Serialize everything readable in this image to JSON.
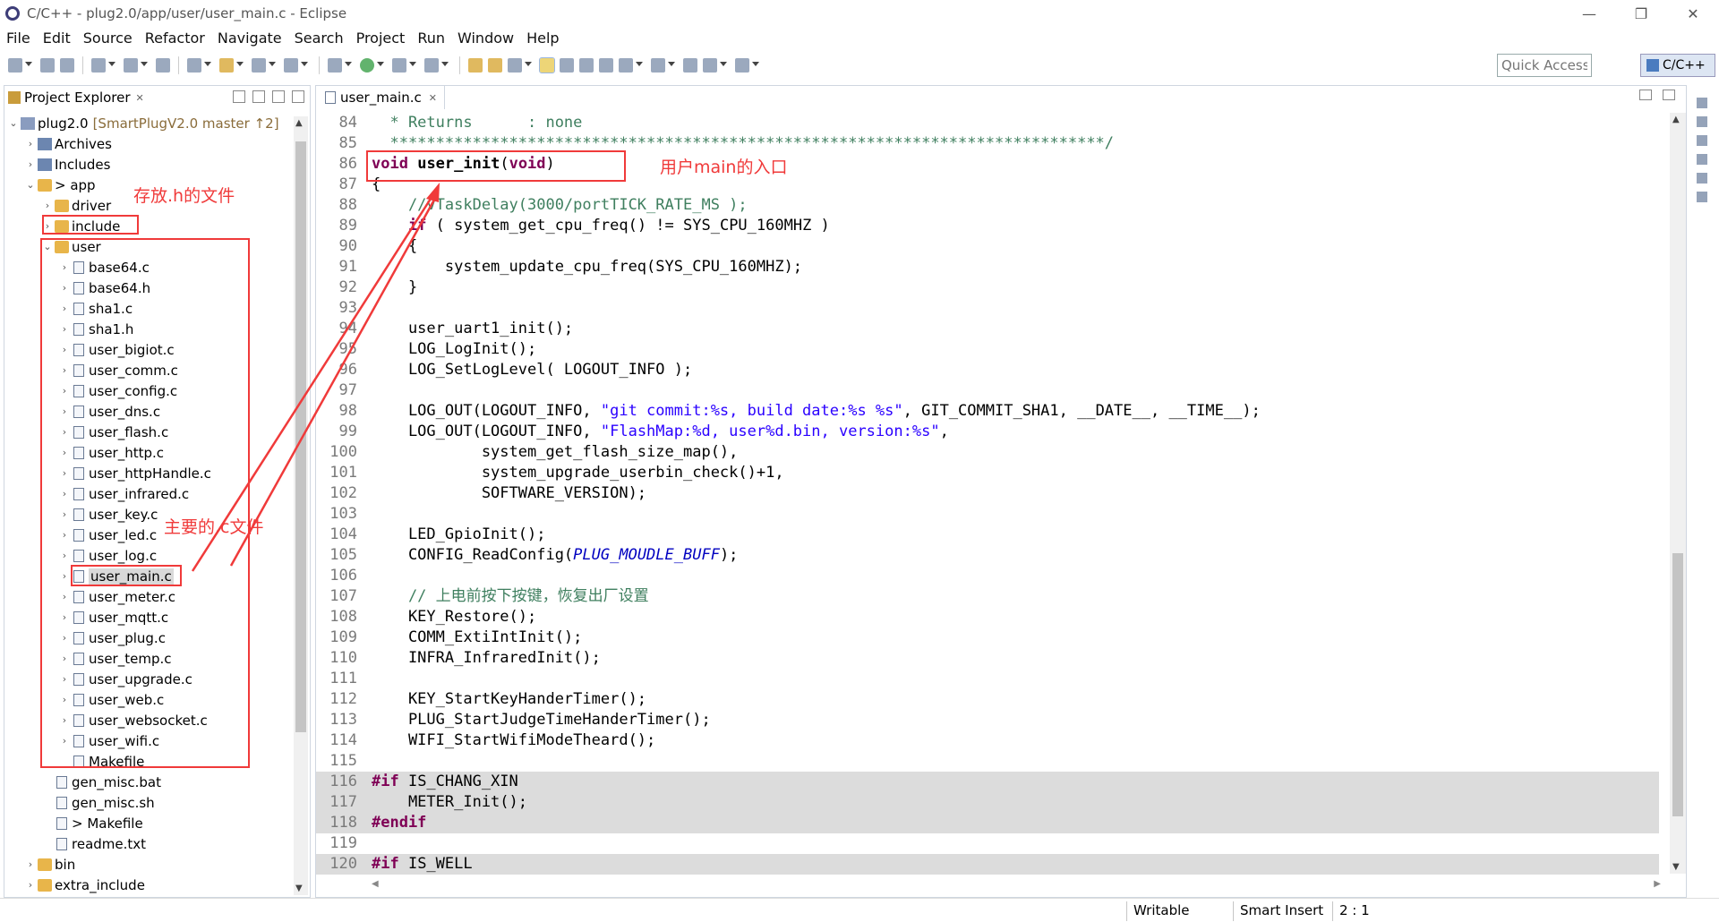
{
  "window": {
    "title": "C/C++ - plug2.0/app/user/user_main.c - Eclipse",
    "controls": [
      "—",
      "❐",
      "✕"
    ]
  },
  "menu": [
    "File",
    "Edit",
    "Source",
    "Refactor",
    "Navigate",
    "Search",
    "Project",
    "Run",
    "Window",
    "Help"
  ],
  "toolbar": {
    "quick_access_placeholder": "Quick Access",
    "perspective": "C/C++"
  },
  "explorer": {
    "title": "Project Explorer",
    "close": "✕",
    "project": {
      "name": "plug2.0",
      "repo": "[SmartPlugV2.0 master ↑2]"
    },
    "items": [
      {
        "label": "Archives",
        "indent": 1,
        "chev": "›",
        "icon": "box"
      },
      {
        "label": "Includes",
        "indent": 1,
        "chev": "›",
        "icon": "box"
      },
      {
        "label": "> app",
        "indent": 1,
        "chev": "⌄",
        "icon": "folder"
      },
      {
        "label": "driver",
        "indent": 2,
        "chev": "›",
        "icon": "folder"
      },
      {
        "label": "include",
        "indent": 2,
        "chev": "›",
        "icon": "folder"
      },
      {
        "label": "user",
        "indent": 2,
        "chev": "⌄",
        "icon": "folder"
      },
      {
        "label": "base64.c",
        "indent": 3,
        "chev": "›",
        "icon": "file"
      },
      {
        "label": "base64.h",
        "indent": 3,
        "chev": "›",
        "icon": "file"
      },
      {
        "label": "sha1.c",
        "indent": 3,
        "chev": "›",
        "icon": "file"
      },
      {
        "label": "sha1.h",
        "indent": 3,
        "chev": "›",
        "icon": "file"
      },
      {
        "label": "user_bigiot.c",
        "indent": 3,
        "chev": "›",
        "icon": "file"
      },
      {
        "label": "user_comm.c",
        "indent": 3,
        "chev": "›",
        "icon": "file"
      },
      {
        "label": "user_config.c",
        "indent": 3,
        "chev": "›",
        "icon": "file"
      },
      {
        "label": "user_dns.c",
        "indent": 3,
        "chev": "›",
        "icon": "file"
      },
      {
        "label": "user_flash.c",
        "indent": 3,
        "chev": "›",
        "icon": "file"
      },
      {
        "label": "user_http.c",
        "indent": 3,
        "chev": "›",
        "icon": "file"
      },
      {
        "label": "user_httpHandle.c",
        "indent": 3,
        "chev": "›",
        "icon": "file"
      },
      {
        "label": "user_infrared.c",
        "indent": 3,
        "chev": "›",
        "icon": "file"
      },
      {
        "label": "user_key.c",
        "indent": 3,
        "chev": "›",
        "icon": "file"
      },
      {
        "label": "user_led.c",
        "indent": 3,
        "chev": "›",
        "icon": "file"
      },
      {
        "label": "user_log.c",
        "indent": 3,
        "chev": "›",
        "icon": "file"
      },
      {
        "label": "user_main.c",
        "indent": 3,
        "chev": "›",
        "icon": "file",
        "selected": true
      },
      {
        "label": "user_meter.c",
        "indent": 3,
        "chev": "›",
        "icon": "file"
      },
      {
        "label": "user_mqtt.c",
        "indent": 3,
        "chev": "›",
        "icon": "file"
      },
      {
        "label": "user_plug.c",
        "indent": 3,
        "chev": "›",
        "icon": "file"
      },
      {
        "label": "user_temp.c",
        "indent": 3,
        "chev": "›",
        "icon": "file"
      },
      {
        "label": "user_upgrade.c",
        "indent": 3,
        "chev": "›",
        "icon": "file"
      },
      {
        "label": "user_web.c",
        "indent": 3,
        "chev": "›",
        "icon": "file"
      },
      {
        "label": "user_websocket.c",
        "indent": 3,
        "chev": "›",
        "icon": "file"
      },
      {
        "label": "user_wifi.c",
        "indent": 3,
        "chev": "›",
        "icon": "file"
      },
      {
        "label": "Makefile",
        "indent": 3,
        "chev": "",
        "icon": "file"
      },
      {
        "label": "gen_misc.bat",
        "indent": 2,
        "chev": "",
        "icon": "file"
      },
      {
        "label": "gen_misc.sh",
        "indent": 2,
        "chev": "",
        "icon": "file"
      },
      {
        "label": "> Makefile",
        "indent": 2,
        "chev": "",
        "icon": "file"
      },
      {
        "label": "readme.txt",
        "indent": 2,
        "chev": "",
        "icon": "file"
      },
      {
        "label": "bin",
        "indent": 1,
        "chev": "›",
        "icon": "folder"
      },
      {
        "label": "extra_include",
        "indent": 1,
        "chev": "›",
        "icon": "folder"
      }
    ]
  },
  "editor": {
    "tab": "user_main.c",
    "close": "✕",
    "lines": [
      {
        "n": "84",
        "t": "  * Returns      : none",
        "cls": "cm"
      },
      {
        "n": "85",
        "t": "  ******************************************************************************/",
        "cls": "cm"
      },
      {
        "n": "86",
        "segs": [
          [
            "kw",
            "void"
          ],
          [
            "",
            " "
          ],
          [
            "bold",
            "user_init"
          ],
          [
            "",
            "("
          ],
          [
            "kw",
            "void"
          ],
          [
            "",
            ")"
          ]
        ]
      },
      {
        "n": "87",
        "t": "{"
      },
      {
        "n": "88",
        "t": "    //vTaskDelay(3000/portTICK_RATE_MS );",
        "cls": "cm"
      },
      {
        "n": "89",
        "segs": [
          [
            "",
            "    "
          ],
          [
            "kw",
            "if"
          ],
          [
            "",
            " ( system_get_cpu_freq() != SYS_CPU_160MHZ )"
          ]
        ]
      },
      {
        "n": "90",
        "t": "    {"
      },
      {
        "n": "91",
        "t": "        system_update_cpu_freq(SYS_CPU_160MHZ);"
      },
      {
        "n": "92",
        "t": "    }"
      },
      {
        "n": "93",
        "t": ""
      },
      {
        "n": "94",
        "t": "    user_uart1_init();"
      },
      {
        "n": "95",
        "t": "    LOG_LogInit();"
      },
      {
        "n": "96",
        "t": "    LOG_SetLogLevel( LOGOUT_INFO );"
      },
      {
        "n": "97",
        "t": ""
      },
      {
        "n": "98",
        "segs": [
          [
            "",
            "    LOG_OUT(LOGOUT_INFO, "
          ],
          [
            "st",
            "\"git commit:%s, build date:%s %s\""
          ],
          [
            "",
            ", GIT_COMMIT_SHA1, __DATE__, __TIME__);"
          ]
        ]
      },
      {
        "n": "99",
        "segs": [
          [
            "",
            "    LOG_OUT(LOGOUT_INFO, "
          ],
          [
            "st",
            "\"FlashMap:%d, user%d.bin, version:%s\""
          ],
          [
            "",
            ","
          ]
        ]
      },
      {
        "n": "100",
        "t": "            system_get_flash_size_map(),"
      },
      {
        "n": "101",
        "t": "            system_upgrade_userbin_check()+1,"
      },
      {
        "n": "102",
        "t": "            SOFTWARE_VERSION);"
      },
      {
        "n": "103",
        "t": ""
      },
      {
        "n": "104",
        "t": "    LED_GpioInit();"
      },
      {
        "n": "105",
        "segs": [
          [
            "",
            "    CONFIG_ReadConfig("
          ],
          [
            "it",
            "PLUG_MOUDLE_BUFF"
          ],
          [
            "",
            ");"
          ]
        ]
      },
      {
        "n": "106",
        "t": ""
      },
      {
        "n": "107",
        "t": "    // 上电前按下按键，恢复出厂设置",
        "cls": "cm"
      },
      {
        "n": "108",
        "t": "    KEY_Restore();"
      },
      {
        "n": "109",
        "t": "    COMM_ExtiIntInit();"
      },
      {
        "n": "110",
        "t": "    INFRA_InfraredInit();"
      },
      {
        "n": "111",
        "t": ""
      },
      {
        "n": "112",
        "t": "    KEY_StartKeyHanderTimer();"
      },
      {
        "n": "113",
        "t": "    PLUG_StartJudgeTimeHanderTimer();"
      },
      {
        "n": "114",
        "t": "    WIFI_StartWifiModeTheard();"
      },
      {
        "n": "115",
        "t": ""
      },
      {
        "n": "116",
        "hl": true,
        "segs": [
          [
            "kw",
            "#if"
          ],
          [
            "",
            " IS_CHANG_XIN"
          ]
        ]
      },
      {
        "n": "117",
        "hl": true,
        "t": "    METER_Init();"
      },
      {
        "n": "118",
        "hl": true,
        "segs": [
          [
            "kw",
            "#endif"
          ]
        ]
      },
      {
        "n": "119",
        "t": ""
      },
      {
        "n": "120",
        "hl": true,
        "segs": [
          [
            "kw",
            "#if"
          ],
          [
            "",
            " IS_WELL"
          ]
        ]
      }
    ]
  },
  "status": {
    "writable": "Writable",
    "insert_mode": "Smart Insert",
    "position": "2 : 1"
  },
  "annotations": {
    "include_note": "存放.h的文件",
    "main_c_note": "主要的.c文件",
    "user_main_note": "用户main的入口",
    "color": "#f03a3a"
  }
}
